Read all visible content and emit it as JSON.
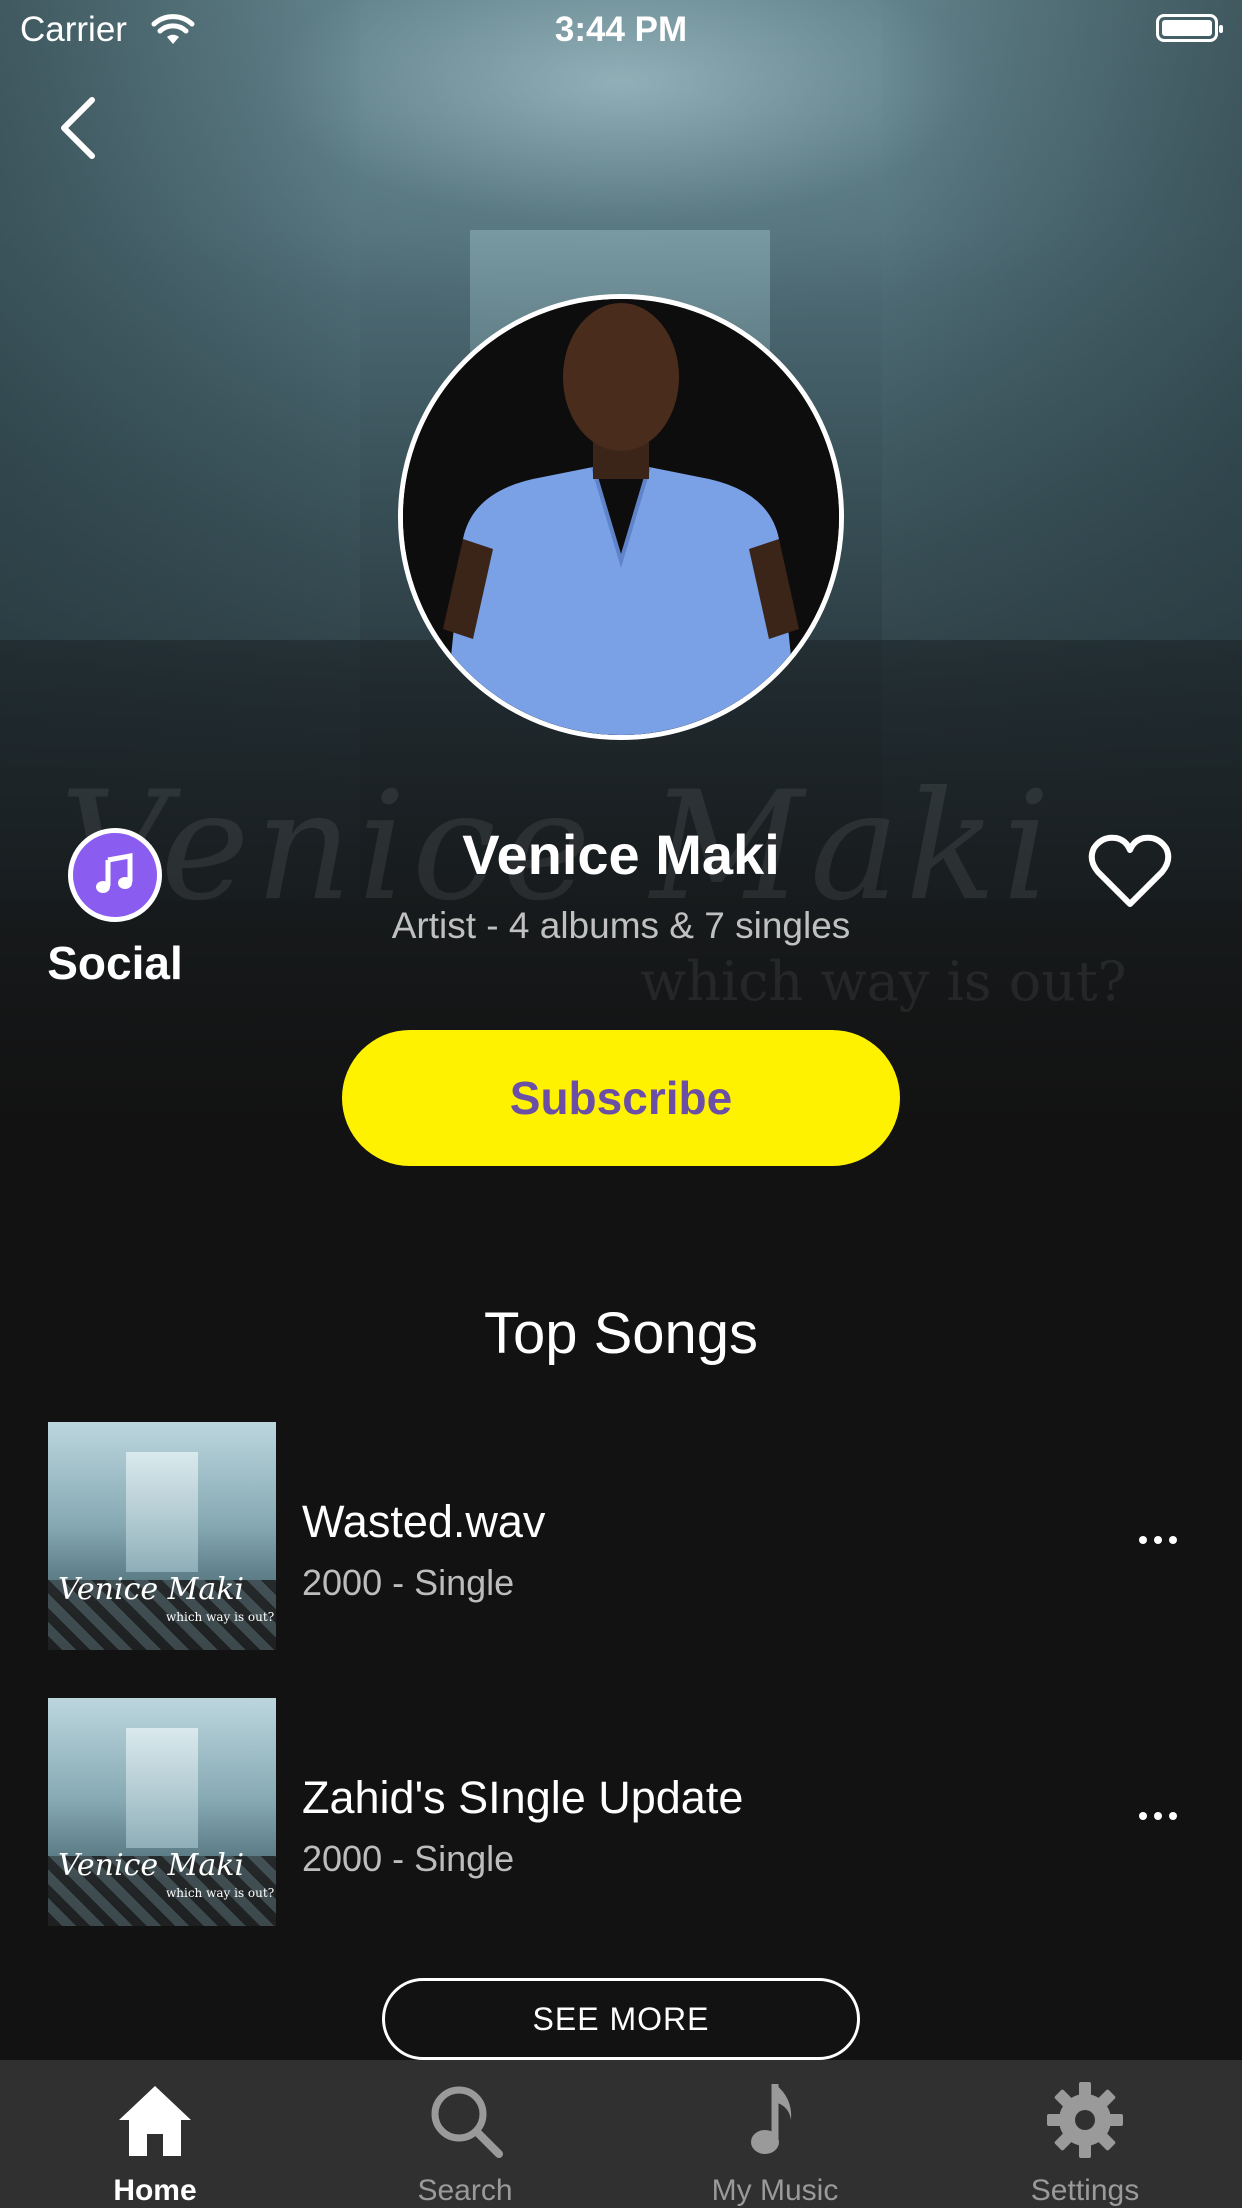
{
  "status_bar": {
    "carrier": "Carrier",
    "time": "3:44 PM"
  },
  "artist": {
    "name": "Venice Maki",
    "meta": "Artist - 4 albums & 7 singles",
    "cover_watermark": "Venice Maki",
    "cover_subtitle": "which way is out?"
  },
  "social": {
    "label": "Social",
    "icon": "music-note-icon",
    "color": "#8a5cf0"
  },
  "subscribe": {
    "label": "Subscribe",
    "background": "#fff200",
    "text_color": "#6b4ea6"
  },
  "top_songs": {
    "title": "Top Songs",
    "songs": [
      {
        "title": "Wasted.wav",
        "meta": "2000 - Single",
        "art_title": "Venice Maki",
        "art_subtitle": "which way is out?"
      },
      {
        "title": "Zahid's SIngle Update",
        "meta": "2000 - Single",
        "art_title": "Venice Maki",
        "art_subtitle": "which way is out?"
      }
    ],
    "see_more": "SEE MORE"
  },
  "tabs": [
    {
      "label": "Home",
      "icon": "home-icon",
      "active": true
    },
    {
      "label": "Search",
      "icon": "search-icon",
      "active": false
    },
    {
      "label": "My Music",
      "icon": "music-note-icon",
      "active": false
    },
    {
      "label": "Settings",
      "icon": "gear-icon",
      "active": false
    }
  ]
}
